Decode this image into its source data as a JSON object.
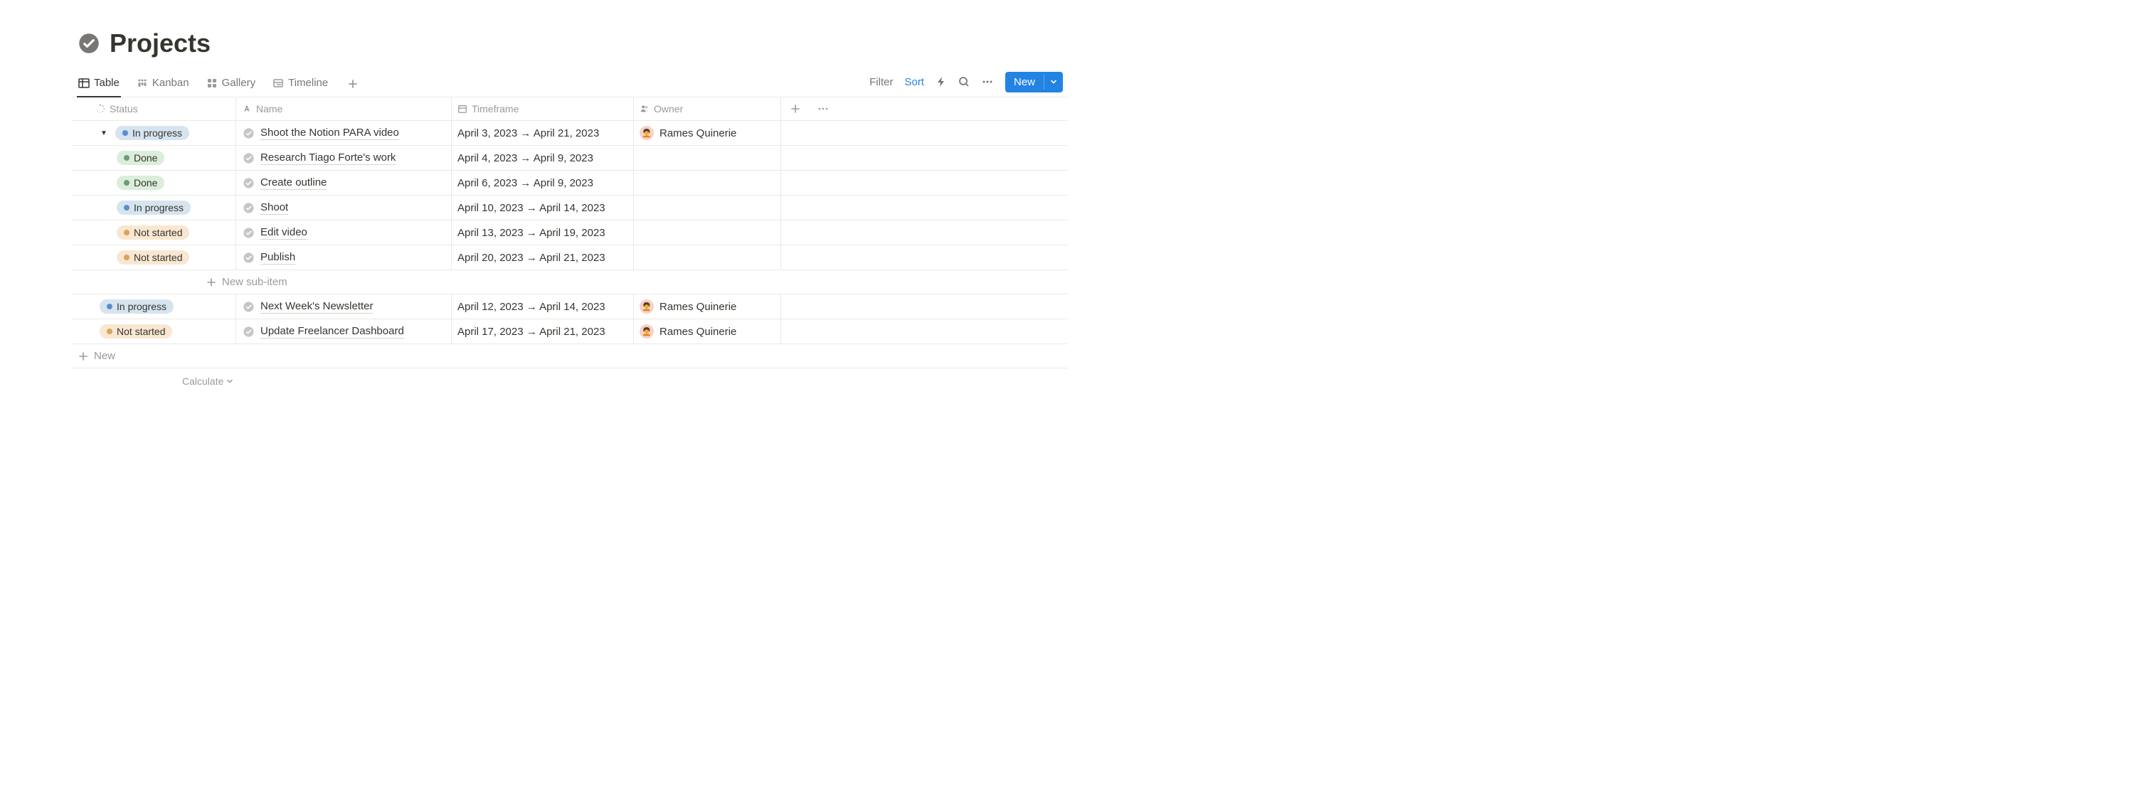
{
  "header": {
    "title": "Projects"
  },
  "tabs": {
    "items": [
      {
        "id": "table",
        "label": "Table",
        "active": true
      },
      {
        "id": "kanban",
        "label": "Kanban",
        "active": false
      },
      {
        "id": "gallery",
        "label": "Gallery",
        "active": false
      },
      {
        "id": "timeline",
        "label": "Timeline",
        "active": false
      }
    ]
  },
  "controls": {
    "filter": "Filter",
    "sort": "Sort",
    "new": "New"
  },
  "columns": {
    "status": "Status",
    "name": "Name",
    "timeframe": "Timeframe",
    "owner": "Owner"
  },
  "status_labels": {
    "in_progress": "In progress",
    "done": "Done",
    "not_started": "Not started"
  },
  "rows": [
    {
      "kind": "parent",
      "expanded": true,
      "status": "in_progress",
      "name": "Shoot the Notion PARA video",
      "timeframe": "April 3, 2023 → April 21, 2023",
      "owner": "Rames Quinerie"
    },
    {
      "kind": "child",
      "status": "done",
      "name": "Research Tiago Forte's work",
      "timeframe": "April 4, 2023 → April 9, 2023",
      "owner": ""
    },
    {
      "kind": "child",
      "status": "done",
      "name": "Create outline",
      "timeframe": "April 6, 2023 → April 9, 2023",
      "owner": ""
    },
    {
      "kind": "child",
      "status": "in_progress",
      "name": "Shoot",
      "timeframe": "April 10, 2023 → April 14, 2023",
      "owner": ""
    },
    {
      "kind": "child",
      "status": "not_started",
      "name": "Edit video",
      "timeframe": "April 13, 2023 → April 19, 2023",
      "owner": ""
    },
    {
      "kind": "child",
      "status": "not_started",
      "name": "Publish",
      "timeframe": "April 20, 2023 → April 21, 2023",
      "owner": ""
    }
  ],
  "new_sub_label": "New sub-item",
  "rows_after": [
    {
      "kind": "parent",
      "status": "in_progress",
      "name": "Next Week's Newsletter",
      "timeframe": "April 12, 2023 → April 14, 2023",
      "owner": "Rames Quinerie"
    },
    {
      "kind": "parent",
      "status": "not_started",
      "name": "Update Freelancer Dashboard",
      "timeframe": "April 17, 2023 → April 21, 2023",
      "owner": "Rames Quinerie"
    }
  ],
  "new_row_label": "New",
  "calculate_label": "Calculate"
}
